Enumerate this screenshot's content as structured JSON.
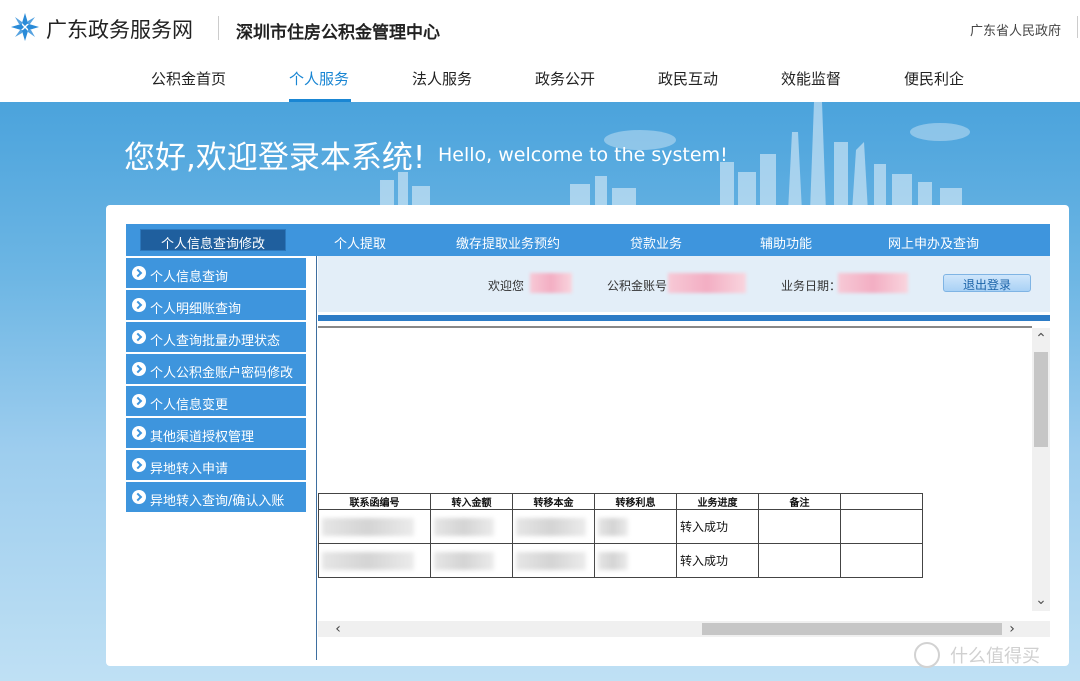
{
  "header": {
    "site_name": "广东政务服务网",
    "center_name": "深圳市住房公积金管理中心",
    "gov_link": "广东省人民政府"
  },
  "mainnav": {
    "items": [
      "公积金首页",
      "个人服务",
      "法人服务",
      "政务公开",
      "政民互动",
      "效能监督",
      "便民利企"
    ],
    "active_index": 1
  },
  "banner": {
    "title_cn": "您好,欢迎登录本系统!",
    "title_en": "Hello, welcome to the system!"
  },
  "subnav": {
    "items": [
      "个人信息查询修改",
      "个人提取",
      "缴存提取业务预约",
      "贷款业务",
      "辅助功能",
      "网上申办及查询"
    ],
    "active_index": 0
  },
  "leftmenu": {
    "items": [
      "个人信息查询",
      "个人明细账查询",
      "个人查询批量办理状态",
      "个人公积金账户密码修改",
      "个人信息变更",
      "其他渠道授权管理",
      "异地转入申请",
      "异地转入查询/确认入账"
    ]
  },
  "infobar": {
    "welcome_label": "欢迎您",
    "account_label": "公积金账号",
    "date_label": "业务日期：",
    "logout_label": "退出登录"
  },
  "table": {
    "headers": [
      "联系函编号",
      "转入金额",
      "转移本金",
      "转移利息",
      "业务进度",
      "备注",
      ""
    ],
    "rows": [
      {
        "status": "转入成功"
      },
      {
        "status": "转入成功"
      }
    ]
  },
  "watermark": {
    "text": "什么值得买",
    "icon": "zhi-icon"
  },
  "colors": {
    "accent": "#1a86d3",
    "nav_blue": "#3e95dd",
    "active_dark": "#1f5f9e"
  }
}
